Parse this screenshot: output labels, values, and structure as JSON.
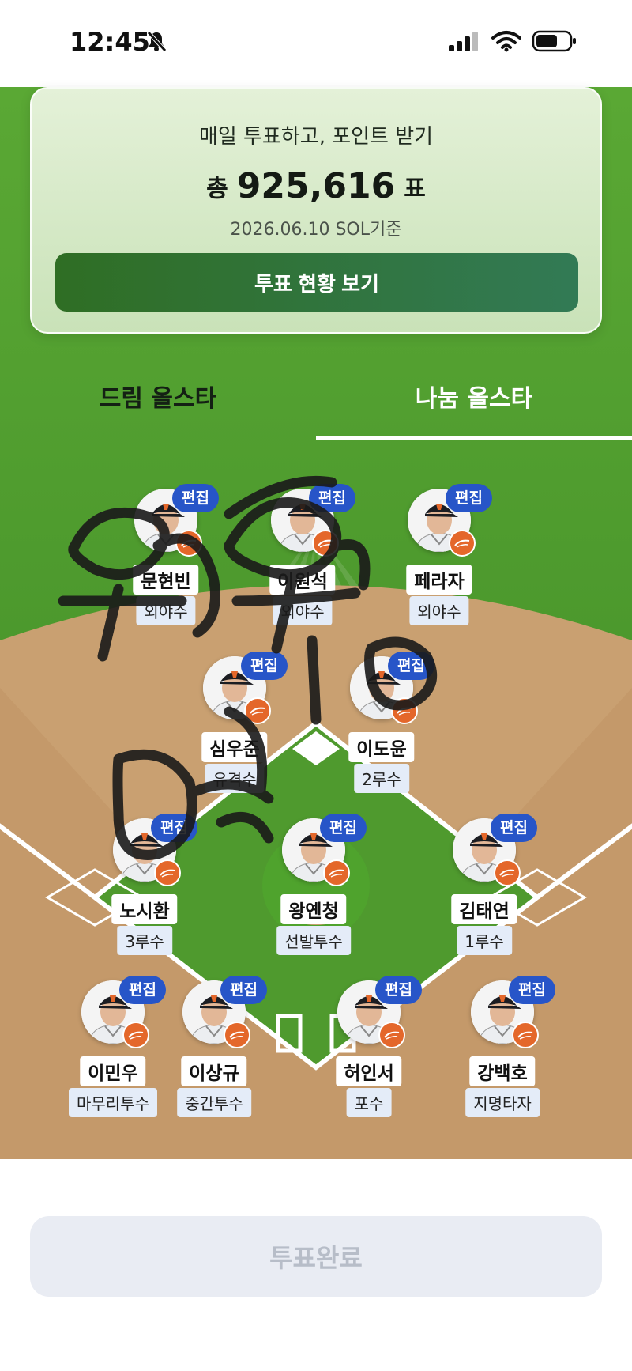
{
  "status_bar": {
    "time": "12:45"
  },
  "vote_card": {
    "heading": "매일 투표하고, 포인트 받기",
    "total_prefix": "총",
    "total_count": "925,616",
    "total_suffix": "표",
    "date_label": "2026.06.10 SOL기준",
    "status_button_label": "투표 현황 보기"
  },
  "tabs": [
    {
      "label": "드림 올스타",
      "active": false
    },
    {
      "label": "나눔 올스타",
      "active": true
    }
  ],
  "edit_label": "편집",
  "players": [
    {
      "name": "문현빈",
      "position": "외야수"
    },
    {
      "name": "이원석",
      "position": "외야수"
    },
    {
      "name": "페라자",
      "position": "외야수"
    },
    {
      "name": "심우준",
      "position": "유격수"
    },
    {
      "name": "이도윤",
      "position": "2루수"
    },
    {
      "name": "노시환",
      "position": "3루수"
    },
    {
      "name": "왕옌청",
      "position": "선발투수"
    },
    {
      "name": "김태연",
      "position": "1루수"
    },
    {
      "name": "이민우",
      "position": "마무리투수"
    },
    {
      "name": "이상규",
      "position": "중간투수"
    },
    {
      "name": "허인서",
      "position": "포수"
    },
    {
      "name": "강백호",
      "position": "지명타자"
    }
  ],
  "handwriting": "웃음 없어 0610",
  "done_button_label": "투표완료",
  "colors": {
    "edit_badge": "#2755c8",
    "field_green": "#4e9a2f",
    "dirt": "#c9a071"
  }
}
